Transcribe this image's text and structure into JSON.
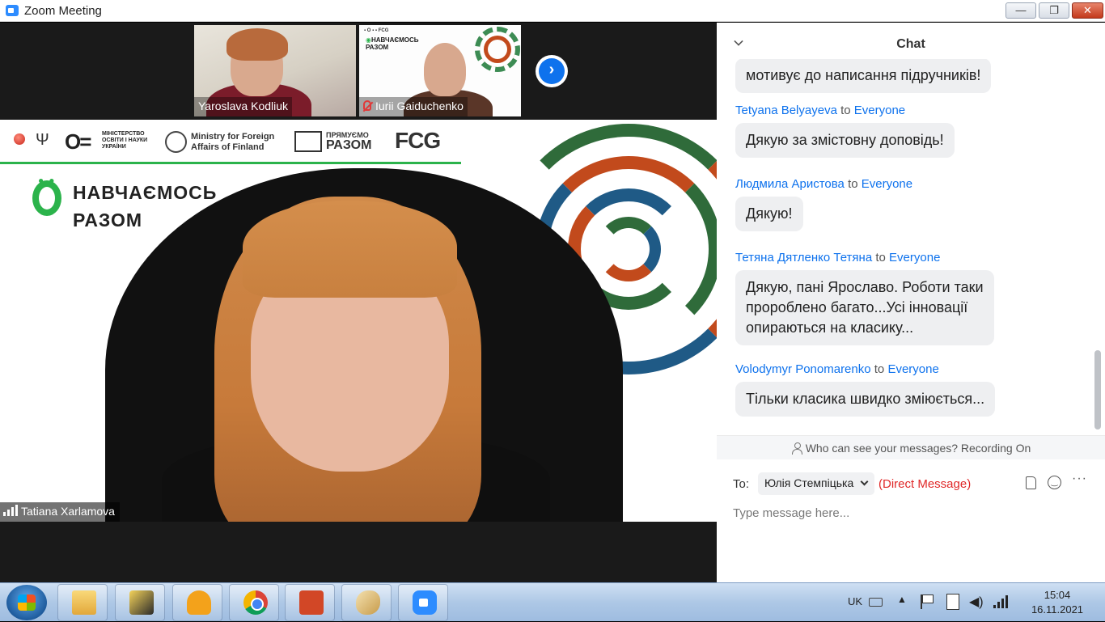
{
  "window": {
    "title": "Zoom Meeting",
    "controls": {
      "minimize": "—",
      "maximize": "❐",
      "close": "✕"
    }
  },
  "thumbnails": [
    {
      "name": "Yaroslava Kodliuk",
      "muted": false
    },
    {
      "name": "Iurii Gaiduchenko",
      "muted": true
    }
  ],
  "next_button": "›",
  "speaker": {
    "name": "Tatiana Xarlamova",
    "slide": {
      "ministry": "МІНІСТЕРСТВО\nОСВІТИ І НАУКИ\nУКРАЇНИ",
      "finland": "Ministry for Foreign\nAffairs of Finland",
      "pryam_top": "ПРЯМУЄМО",
      "pryam_bottom": "РАЗОМ",
      "fcg": "FCG",
      "brand": "НАВЧАЄМОСЬ\nРАЗОМ"
    }
  },
  "chat": {
    "title": "Chat",
    "partial_message": "мотивує до написання підручників!",
    "messages": [
      {
        "sender": "Tetyana Belyayeva",
        "to": "to",
        "recipient": "Everyone",
        "text": "Дякую за змістовну доповідь!"
      },
      {
        "sender": "Людмила Аристова",
        "to": "to",
        "recipient": "Everyone",
        "text": "Дякую!"
      },
      {
        "sender": "Тетяна Дятленко Тетяна",
        "to": "to",
        "recipient": "Everyone",
        "text": "Дякую, пані Ярославо. Роботи таки\nпророблено багато...Усі інновації\nопираються на класику..."
      },
      {
        "sender": "Volodymyr Ponomarenko",
        "to": "to",
        "recipient": "Everyone",
        "text": "Тільки класика швидко зміюється..."
      }
    ],
    "privacy_notice": "Who can see your messages? Recording On",
    "compose": {
      "to_label": "To:",
      "recipient": "Юлія Стемпіцька",
      "direct_message": "(Direct Message)",
      "more": "···",
      "placeholder": "Type message here..."
    }
  },
  "taskbar": {
    "apps": [
      "folder-icon",
      "app-icon",
      "pdf-icon",
      "chrome-icon",
      "powerpoint-icon",
      "paint-icon",
      "zoom-icon"
    ],
    "tray": {
      "language": "UK",
      "time": "15:04",
      "date": "16.11.2021"
    }
  },
  "colors": {
    "zoom_blue": "#0e72ed",
    "brand_green": "#2bb34b",
    "direct_message_red": "#e02828"
  }
}
